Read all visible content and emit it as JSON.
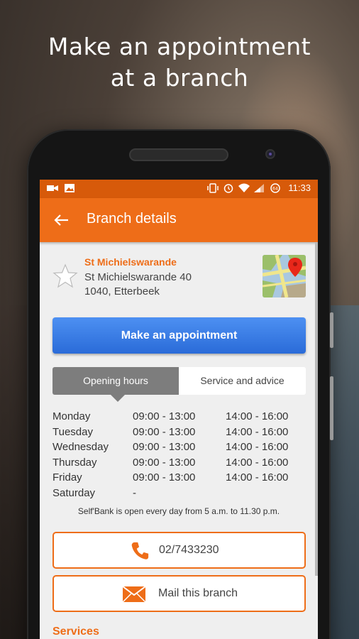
{
  "headline": {
    "line1": "Make an appointment",
    "line2": "at a branch"
  },
  "status_bar": {
    "time": "11:33",
    "icons": [
      "video-icon",
      "image-icon",
      "vibrate-icon",
      "alarm-icon",
      "wifi-icon",
      "signal-icon",
      "battery-icon"
    ]
  },
  "app_bar": {
    "title": "Branch details",
    "back_icon": "arrow-left-icon"
  },
  "branch": {
    "name": "St Michielswarande",
    "address_line1": "St Michielswarande 40",
    "address_line2": "1040, Etterbeek",
    "favorite_icon": "star-outline-icon",
    "map_icon": "map-pin-icon"
  },
  "appointment_button": {
    "label": "Make an appointment"
  },
  "tabs": [
    {
      "label": "Opening hours",
      "active": true
    },
    {
      "label": "Service and advice",
      "active": false
    }
  ],
  "opening_hours": [
    {
      "day": "Monday",
      "am": "09:00 - 13:00",
      "pm": "14:00 - 16:00"
    },
    {
      "day": "Tuesday",
      "am": "09:00 - 13:00",
      "pm": "14:00 - 16:00"
    },
    {
      "day": "Wednesday",
      "am": "09:00 - 13:00",
      "pm": "14:00 - 16:00"
    },
    {
      "day": "Thursday",
      "am": "09:00 - 13:00",
      "pm": "14:00 - 16:00"
    },
    {
      "day": "Friday",
      "am": "09:00 - 13:00",
      "pm": "14:00 - 16:00"
    },
    {
      "day": "Saturday",
      "am": "-",
      "pm": ""
    }
  ],
  "selfbank_note": "Self'Bank is open every day from 5 a.m. to 11.30 p.m.",
  "call_button": {
    "label": "02/7433230",
    "icon": "phone-icon"
  },
  "mail_button": {
    "label": "Mail this branch",
    "icon": "envelope-icon"
  },
  "section_title": "Services",
  "colors": {
    "status_bar": "#d75a0a",
    "app_bar": "#ee6d18",
    "accent": "#ee6d18",
    "primary_button": "#3a7de6",
    "active_tab": "#7d7d7d"
  }
}
